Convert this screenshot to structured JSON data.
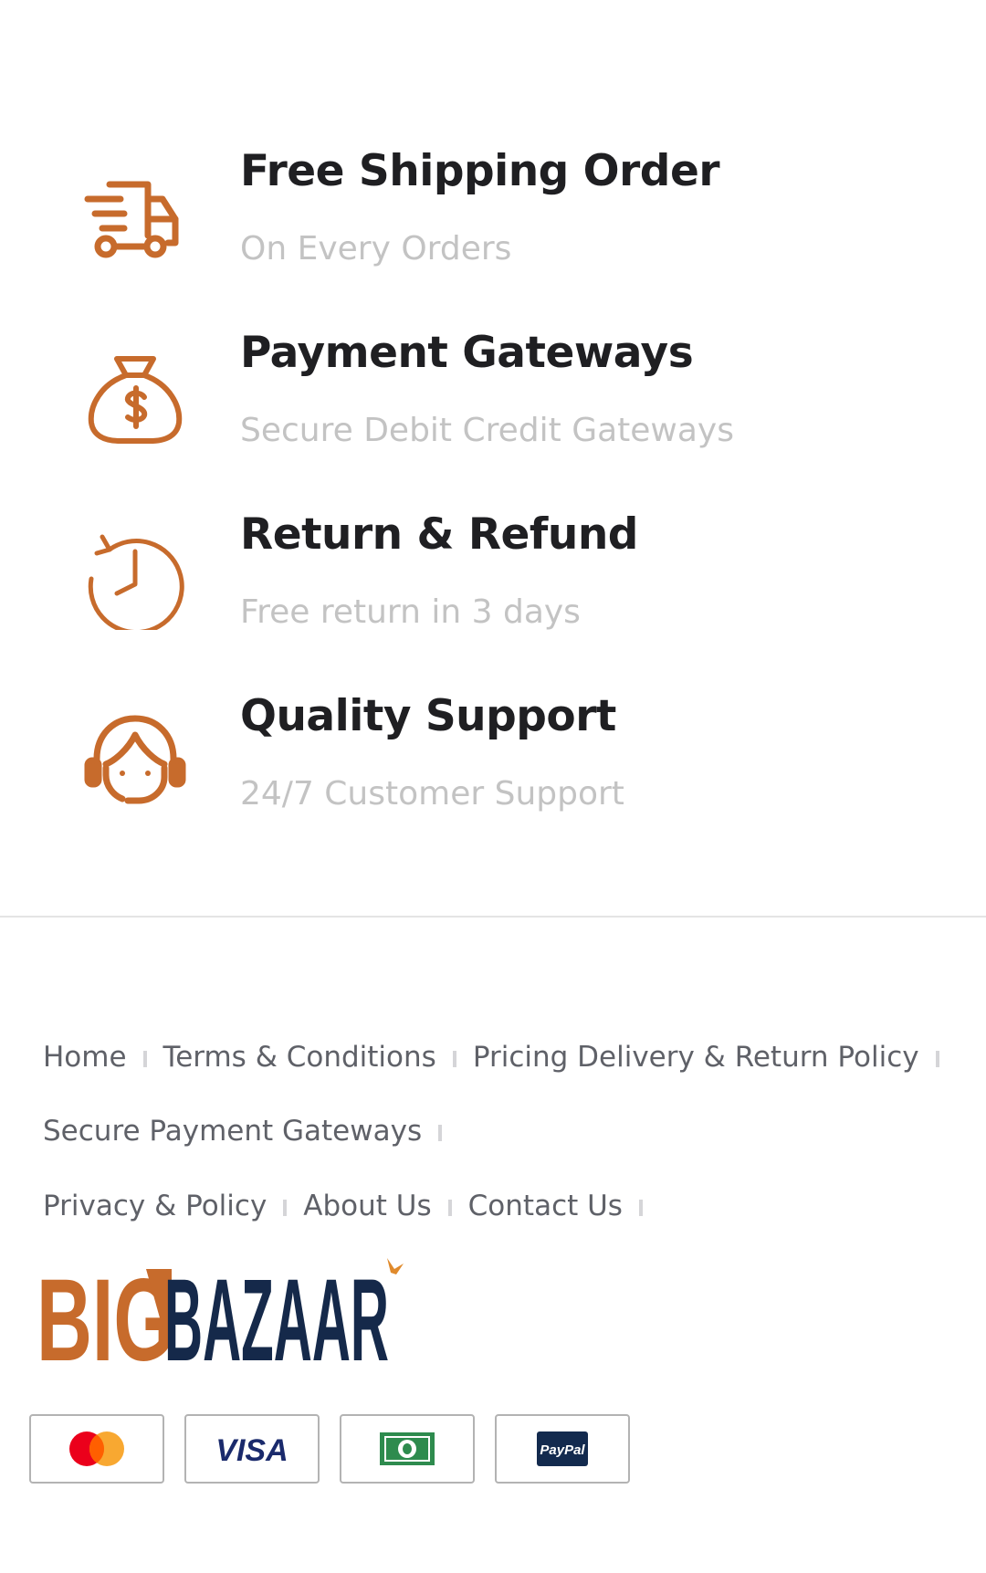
{
  "colors": {
    "accent": "#C76B2C",
    "title": "#1F1F22",
    "subtitle": "#C3C3C3",
    "link": "#5F6168",
    "logo_dark": "#15294A",
    "paypal_dark": "#132A4E",
    "cash_green": "#2E8B4E",
    "mastercard_red": "#EB001B",
    "mastercard_orange": "#F79E1B"
  },
  "features": [
    {
      "icon": "truck-icon",
      "title": "Free Shipping Order",
      "subtitle": "On Every Orders"
    },
    {
      "icon": "money-bag-icon",
      "title": "Payment Gateways",
      "subtitle": "Secure Debit Credit Gateways"
    },
    {
      "icon": "clock-history-icon",
      "title": "Return & Refund",
      "subtitle": "Free return in 3 days"
    },
    {
      "icon": "support-agent-icon",
      "title": "Quality Support",
      "subtitle": "24/7 Customer Support"
    }
  ],
  "footer": {
    "links_row1": [
      "Home",
      "Terms & Conditions",
      "Pricing Delivery & Return Policy"
    ],
    "links_row2": [
      "Secure Payment Gateways"
    ],
    "links_row3": [
      "Privacy & Policy",
      "About Us",
      "Contact Us"
    ]
  },
  "logo": {
    "text_big": "BIG",
    "text_bazaar": "BAZAAR"
  },
  "payments": [
    {
      "icon": "mastercard-icon"
    },
    {
      "icon": "visa-icon",
      "label": "VISA"
    },
    {
      "icon": "cash-icon"
    },
    {
      "icon": "paypal-icon",
      "label": "PayPal"
    }
  ]
}
